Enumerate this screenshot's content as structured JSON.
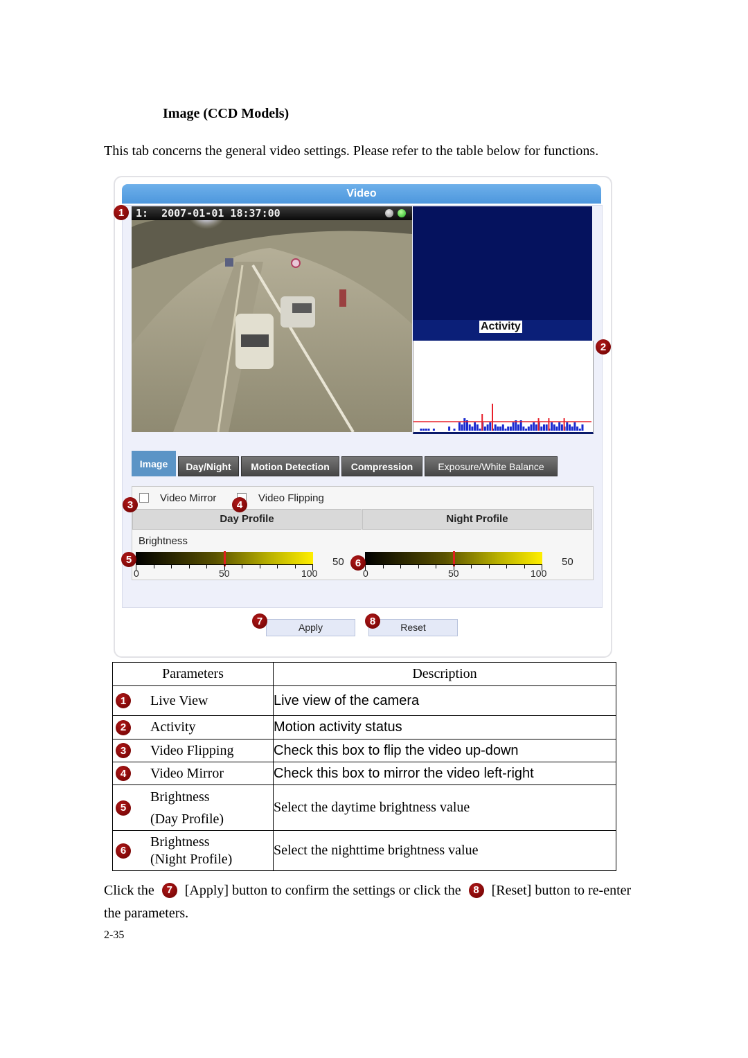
{
  "heading": "Image (CCD Models)",
  "intro": "This tab concerns the general video settings. Please refer to the table below for functions.",
  "ui": {
    "panel_title": "Video",
    "live_view": {
      "channel": "1:",
      "timestamp": "2007-01-01 18:37:00"
    },
    "activity": {
      "label": "Activity",
      "threshold_color": "#e8202a",
      "bar_color": "#1a2ad0"
    },
    "tabs": [
      {
        "label": "Image",
        "active": true
      },
      {
        "label": "Day/Night",
        "active": false
      },
      {
        "label": "Motion Detection",
        "active": false
      },
      {
        "label": "Compression",
        "active": false
      },
      {
        "label": "Exposure/White Balance",
        "active": false
      }
    ],
    "checkboxes": {
      "mirror": {
        "label": "Video Mirror",
        "checked": false
      },
      "flipping": {
        "label": "Video Flipping",
        "checked": false
      }
    },
    "profiles": {
      "day": {
        "header": "Day Profile",
        "value": "50",
        "value_pct": 50
      },
      "night": {
        "header": "Night Profile",
        "value": "50",
        "value_pct": 50
      }
    },
    "brightness_label": "Brightness",
    "scale": {
      "min": "0",
      "mid": "50",
      "max": "100"
    },
    "buttons": {
      "apply": "Apply",
      "reset": "Reset"
    },
    "callouts": [
      "1",
      "2",
      "3",
      "4",
      "5",
      "6",
      "7",
      "8"
    ]
  },
  "table": {
    "headers": [
      "Parameters",
      "Description"
    ],
    "rows": [
      {
        "num": "1",
        "param": "Live View",
        "param2": "",
        "desc": "Live view of the camera"
      },
      {
        "num": "2",
        "param": "Activity",
        "param2": "",
        "desc": "Motion activity status"
      },
      {
        "num": "3",
        "param": "Video Flipping",
        "param2": "",
        "desc": "Check this box to flip the video up-down"
      },
      {
        "num": "4",
        "param": "Video Mirror",
        "param2": "",
        "desc": "Check this box to mirror the video left-right"
      },
      {
        "num": "5",
        "param": "Brightness",
        "param2": "(Day Profile)",
        "desc": "Select the daytime brightness value"
      },
      {
        "num": "6",
        "param": "Brightness",
        "param2": "(Night Profile)",
        "desc": "Select the nighttime brightness value"
      }
    ]
  },
  "footer": {
    "part1": "Click the",
    "num1": "7",
    "part2": "[Apply] button to confirm the settings or click the",
    "num2": "8",
    "part3": "[Reset] button to re-enter the parameters."
  },
  "page_number": "2-35"
}
